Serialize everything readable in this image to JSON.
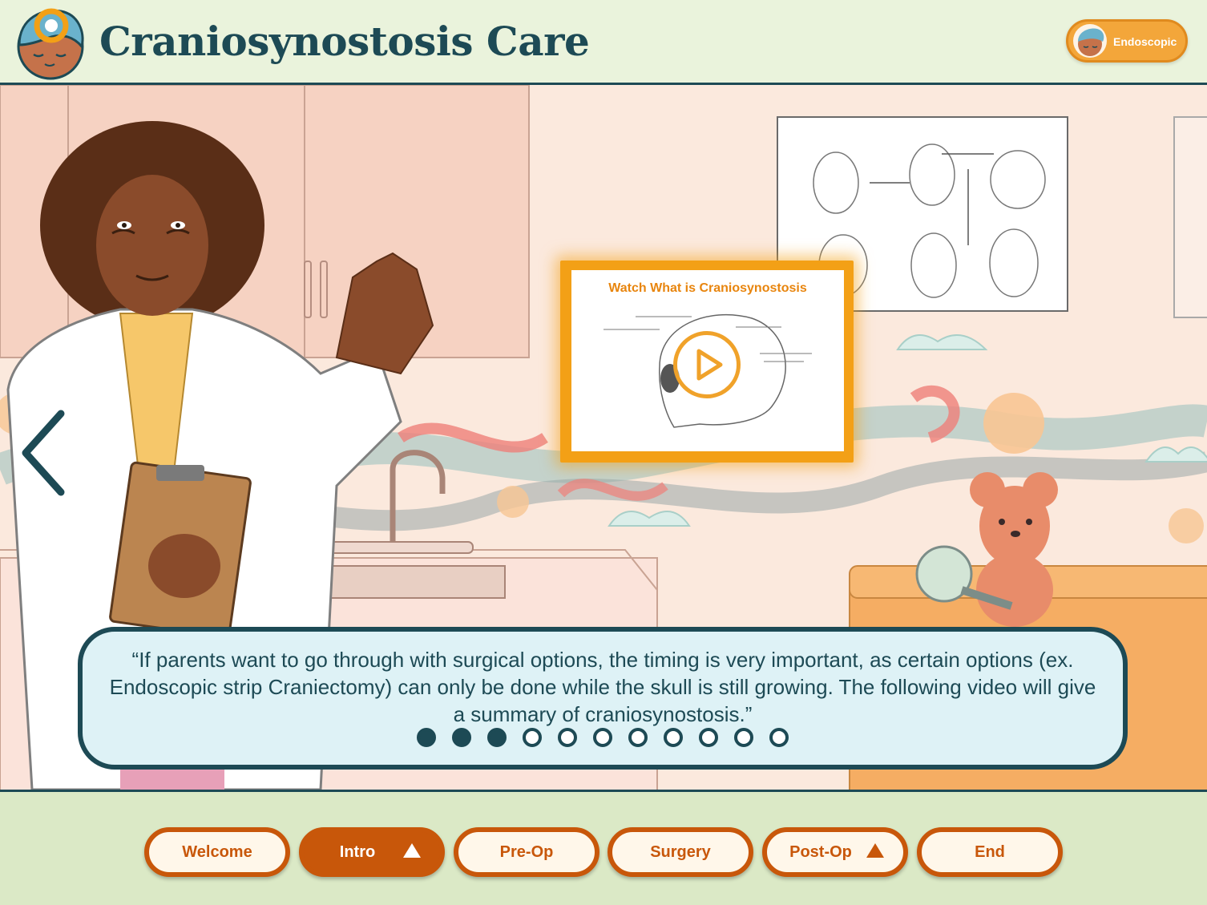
{
  "app": {
    "title": "Craniosynostosis Care"
  },
  "mode_badge": {
    "label": "Endoscopic",
    "icon": "baby-avatar-icon"
  },
  "video_card": {
    "title": "Watch What is Craniosynostosis",
    "icon": "play-icon"
  },
  "dialogue": {
    "text": "“If parents want to go through with surgical options, the timing is very important, as certain options (ex. Endoscopic strip Craniectomy) can only be done while the skull is still growing. The following video will give a summary of craniosynostosis.”",
    "progress": {
      "total": 11,
      "current": 3
    }
  },
  "nav_back": {
    "icon": "chevron-left-icon"
  },
  "bottom_nav": {
    "items": [
      {
        "label": "Welcome",
        "active": false,
        "expand_icon": false
      },
      {
        "label": "Intro",
        "active": true,
        "expand_icon": true
      },
      {
        "label": "Pre-Op",
        "active": false,
        "expand_icon": false
      },
      {
        "label": "Surgery",
        "active": false,
        "expand_icon": false
      },
      {
        "label": "Post-Op",
        "active": false,
        "expand_icon": true
      },
      {
        "label": "End",
        "active": false,
        "expand_icon": false
      }
    ]
  },
  "colors": {
    "primary": "#1d4a55",
    "accent": "#c8570a",
    "highlight": "#f3a016",
    "header_bg": "#eaf3dc",
    "dialog_bg": "#def2f6"
  }
}
